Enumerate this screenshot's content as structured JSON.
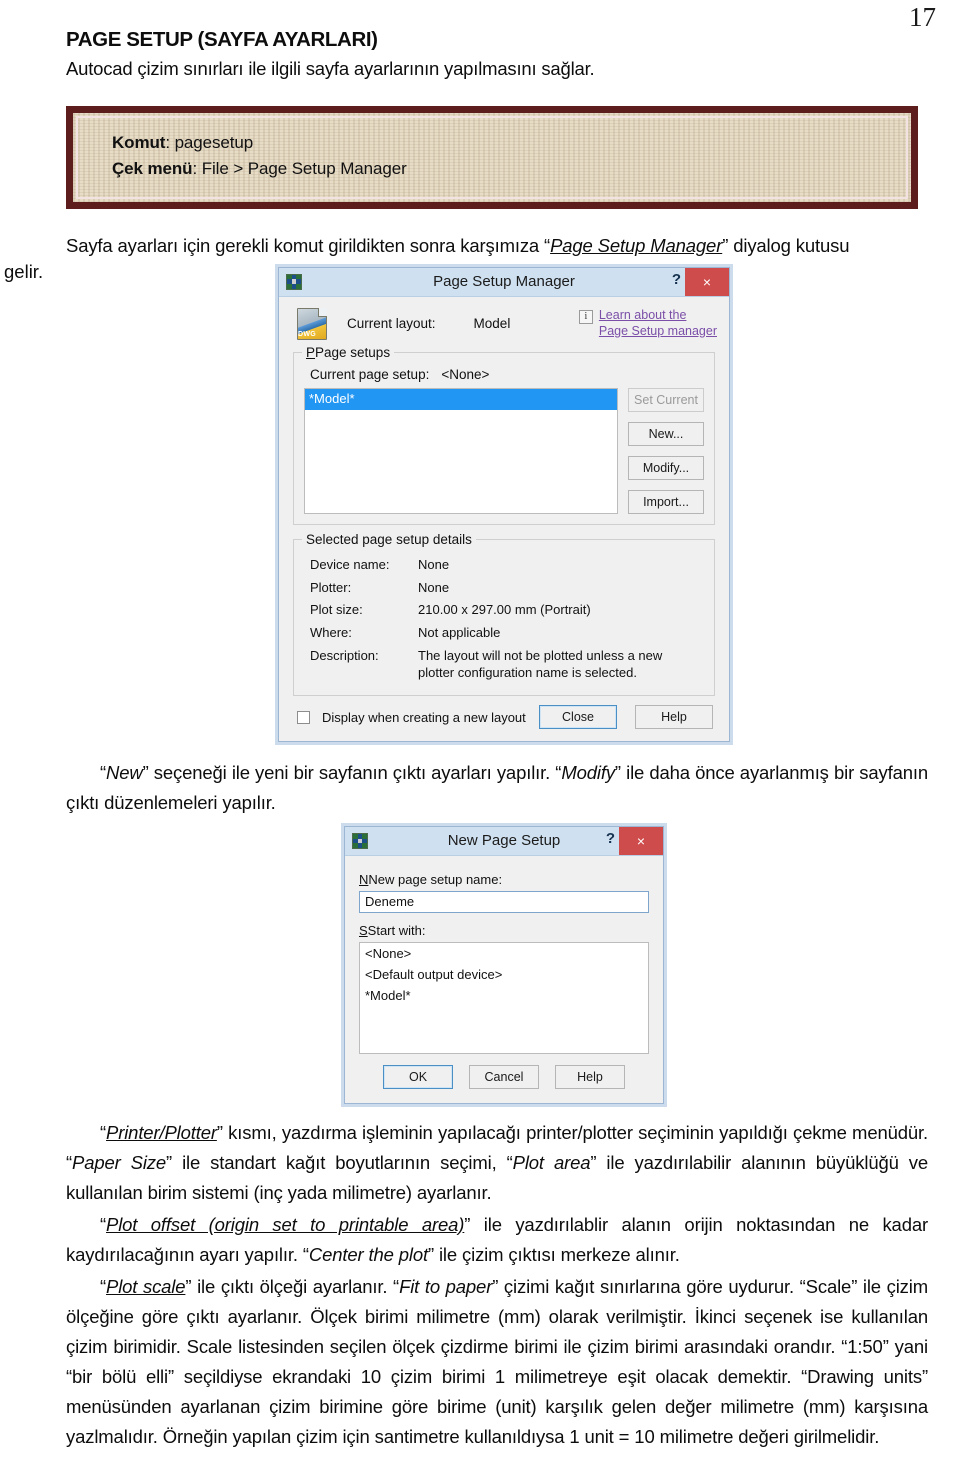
{
  "page": {
    "number": "17"
  },
  "doc": {
    "title": "PAGE SETUP (SAYFA AYARLARI)",
    "lead": "Autocad çizim sınırları ile ilgili sayfa ayarlarının yapılmasını sağlar.",
    "komut_box": {
      "komut_label": "Komut",
      "komut_value": ": pagesetup",
      "menu_label": "Çek menü",
      "menu_value": ": File > Page Setup Manager"
    },
    "para_intro_a": "Sayfa ayarları için gerekli komut girildikten sonra karşımıza “",
    "para_intro_em": "Page Setup Manager",
    "para_intro_b": "” diyalog kutusu",
    "para_intro_hang": "gelir.",
    "para_new_modify": {
      "a": "“",
      "em1": "New",
      "b": "” seçeneği ile yeni bir sayfanın çıktı ayarları yapılır. “",
      "em2": "Modify",
      "c": "” ile daha önce ayarlanmış bir sayfanın çıktı düzenlemeleri yapılır."
    },
    "para_printer": {
      "a": "“",
      "em1": "Printer/Plotter",
      "b": "” kısmı, yazdırma işleminin yapılacağı printer/plotter seçiminin yapıldığı çekme menüdür. “",
      "em2": "Paper Size",
      "c": "” ile standart kağıt boyutlarının seçimi, “",
      "em3": "Plot area",
      "d": "” ile yazdırılabilir alanının büyüklüğü ve kullanılan birim sistemi (inç yada milimetre) ayarlanır."
    },
    "para_offset": {
      "a": "“",
      "em1": "Plot offset (origin set to printable area)",
      "b": "” ile yazdırılablir alanın orijin noktasından ne kadar kaydırılacağının ayarı yapılır. “",
      "em2": "Center the plot",
      "c": "” ile çizim çıktısı merkeze alınır."
    },
    "para_scale": {
      "a": "“",
      "em1": "Plot scale",
      "b": "” ile çıktı ölçeği ayarlanır. “",
      "em2": "Fit to paper",
      "c": "” çizimi kağıt sınırlarına göre uydurur. “Scale” ile çizim ölçeğine göre çıktı ayarlanır. Ölçek birimi milimetre (mm) olarak verilmiştir. İkinci seçenek ise kullanılan çizim birimidir. Scale listesinden seçilen ölçek çizdirme birimi ile çizim birimi arasındaki orandır. “1:50” yani “bir bölü elli” seçildiyse ekrandaki 10 çizim birimi 1 milimetreye eşit olacak demektir. “Drawing units” menüsünden ayarlanan çizim birimine göre birime (unit) karşılık gelen değer milimetre (mm) karşısına yazlmalıdır. Örneğin yapılan çizim için santimetre kullanıldıysa 1 unit = 10 milimetre değeri girilmelidir."
    }
  },
  "dialog_page_setup_manager": {
    "title": "Page Setup Manager",
    "icon": "autocad-app-icon",
    "help_q": "?",
    "close": "×",
    "current_layout_label": "Current layout:",
    "current_layout_value": "Model",
    "info_icon": "i",
    "learn_link_line1": "Learn about the",
    "learn_link_line2": "Page Setup manager",
    "group_page_setups": "Page setups",
    "current_page_setup_label": "Current page setup:",
    "current_page_setup_value": "<None>",
    "list_items": [
      {
        "label": "*Model*",
        "selected": true
      }
    ],
    "buttons": [
      {
        "label": "Set Current",
        "disabled": true
      },
      {
        "label": "New...",
        "disabled": false
      },
      {
        "label": "Modify...",
        "disabled": false
      },
      {
        "label": "Import...",
        "disabled": false
      }
    ],
    "group_details": "Selected page setup details",
    "details": [
      {
        "key": "Device name:",
        "value": "None"
      },
      {
        "key": "Plotter:",
        "value": "None"
      },
      {
        "key": "Plot size:",
        "value": "210.00 x 297.00 mm (Portrait)"
      },
      {
        "key": "Where:",
        "value": "Not applicable"
      },
      {
        "key": "Description:",
        "value": "The layout will not be plotted unless a new plotter configuration name is selected."
      }
    ],
    "checkbox_label": "Display when creating a new layout",
    "checkbox_checked": false,
    "close_button": "Close",
    "help_button": "Help"
  },
  "dialog_new_page_setup": {
    "title": "New Page Setup",
    "icon": "autocad-app-icon",
    "help_q": "?",
    "close": "×",
    "name_label": "New page setup name:",
    "name_value": "Deneme",
    "start_with_label": "Start with:",
    "start_with_items": [
      {
        "label": "<None>",
        "highlight": false
      },
      {
        "label": "<Default output device>",
        "highlight": false
      },
      {
        "label": "*Model*",
        "highlight": true
      }
    ],
    "ok_button": "OK",
    "cancel_button": "Cancel",
    "help_button": "Help"
  },
  "colors": {
    "box_border": "#5e1d1d",
    "box_fill": "#e7dcc6",
    "titlebar": "#cfe0f0",
    "close_red": "#cf4c4c",
    "selection_blue": "#2196f3",
    "link_purple": "#7b4fa8"
  }
}
